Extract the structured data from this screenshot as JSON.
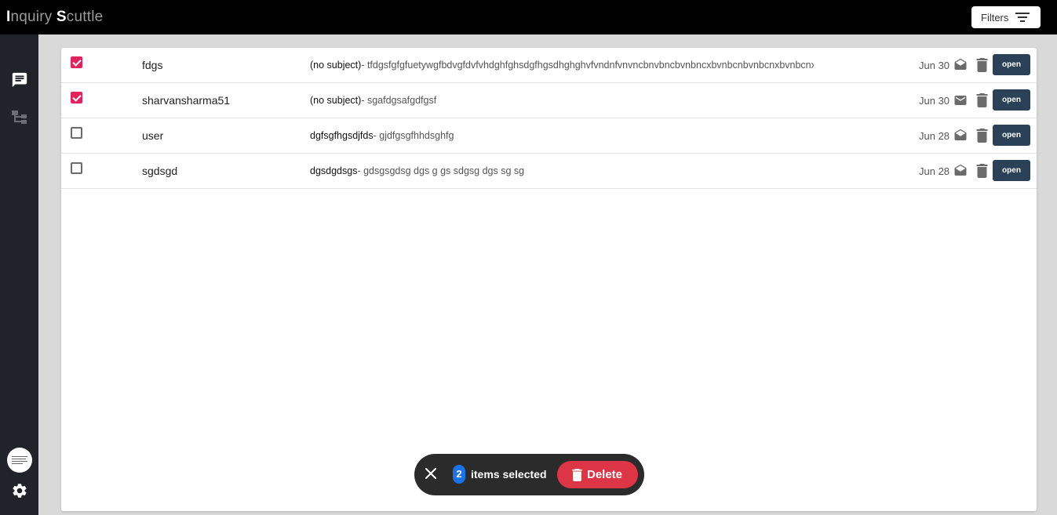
{
  "app": {
    "title_parts": [
      "I",
      "nquiry ",
      "S",
      "cuttle"
    ]
  },
  "header": {
    "filters_label": "Filters",
    "filter_icon": "filter-lines-icon"
  },
  "sidebar": {
    "items": [
      {
        "icon": "chat-icon"
      },
      {
        "icon": "hierarchy-icon"
      }
    ],
    "settings_icon": "gear-icon"
  },
  "messages": [
    {
      "checked": true,
      "sender": "fdgs",
      "subject": "(no subject)",
      "preview": "- tfdgsfgfgfuetywgfbdvgfdvfvhdghfghsdgfhgsdhghghvfvndnfvnvncbnvbncbvnbncxbvnbcnbvnbcnxbvnbcnxbvnbcnx",
      "date": "Jun 30",
      "read": true,
      "open_label": "open"
    },
    {
      "checked": true,
      "sender": "sharvansharma51",
      "subject": "(no subject)",
      "preview": "- sgafdgsafgdfgsf",
      "date": "Jun 30",
      "read": false,
      "open_label": "open"
    },
    {
      "checked": false,
      "sender": "user",
      "subject": "dgfsgfhgsdjfds",
      "preview": "- gjdfgsgfhhdsghfg",
      "date": "Jun 28",
      "read": true,
      "open_label": "open"
    },
    {
      "checked": false,
      "sender": "sgdsgd",
      "subject": "dgsdgdsgs",
      "preview": "- gdsgsgdsg dgs g gs sdgsg dgs sg sg",
      "date": "Jun 28",
      "read": true,
      "open_label": "open"
    }
  ],
  "selection_bar": {
    "count": "2",
    "label": "items selected",
    "delete_label": "Delete"
  },
  "colors": {
    "accent_checkbox": "#e0245e",
    "open_button": "#2a4157",
    "delete_button": "#dc3545",
    "count_badge": "#1a73e8"
  }
}
